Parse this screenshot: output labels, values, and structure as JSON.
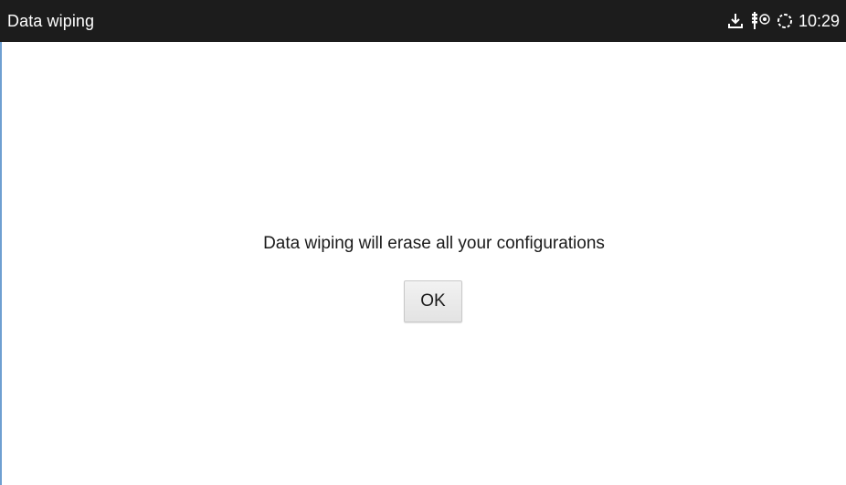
{
  "status_bar": {
    "title": "Data wiping",
    "clock": "10:29",
    "icons": [
      "download-icon",
      "usb-debug-icon",
      "sync-icon"
    ]
  },
  "dialog": {
    "message": "Data wiping will erase all your configurations",
    "ok_label": "OK"
  },
  "colors": {
    "status_bar_bg": "#1c1c1c",
    "page_bg": "#ffffff",
    "accent_edge": "#6f9fd1"
  }
}
